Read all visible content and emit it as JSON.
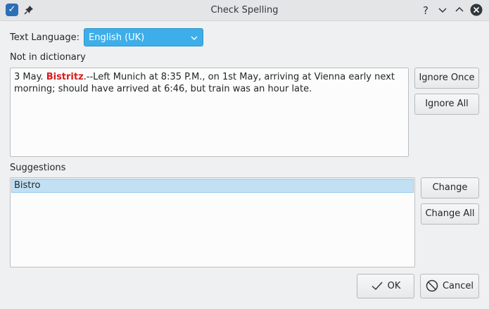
{
  "window": {
    "title": "Check Spelling",
    "app_icon_glyph": "✓",
    "controls": [
      "help-icon",
      "minimize-icon",
      "maximize-icon",
      "close-icon"
    ]
  },
  "language": {
    "label": "Text Language:",
    "selected": "English (UK)"
  },
  "not_in_dictionary": {
    "label": "Not in dictionary",
    "text_before": "3 May. ",
    "misspelled_word": "Bistritz",
    "text_after": ".--Left Munich at 8:35 P.M., on 1st May, arriving at Vienna early next morning; should have arrived at 6:46, but train was an hour late."
  },
  "suggestions": {
    "label": "Suggestions",
    "items": [
      "Bistro"
    ],
    "selected_index": 0
  },
  "buttons": {
    "ignore_once": "Ignore Once",
    "ignore_all": "Ignore All",
    "change": "Change",
    "change_all": "Change All",
    "ok": "OK",
    "cancel": "Cancel"
  },
  "colors": {
    "accent": "#3daee9",
    "misspelled": "#da1b1b",
    "selection": "#c2e0f4"
  }
}
